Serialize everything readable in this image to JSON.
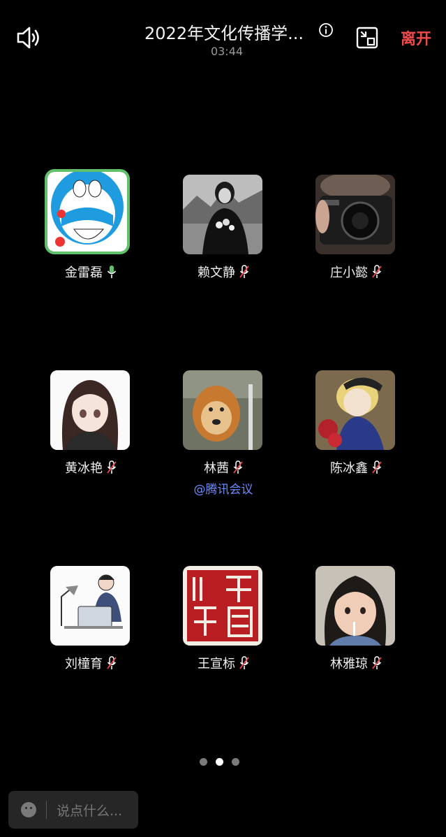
{
  "header": {
    "title": "2022年文化传播学...",
    "timer": "03:44",
    "leave_label": "离开",
    "icons": [
      "speaker-icon",
      "info-icon",
      "shrink-window-icon"
    ]
  },
  "participants": [
    {
      "name": "金雷磊",
      "mic": "on",
      "speaking": true
    },
    {
      "name": "赖文静",
      "mic": "muted"
    },
    {
      "name": "庄小懿",
      "mic": "muted"
    },
    {
      "name": "黄冰艳",
      "mic": "muted"
    },
    {
      "name": "林茜",
      "mic": "muted",
      "sublabel": "@腾讯会议"
    },
    {
      "name": "陈冰鑫",
      "mic": "muted"
    },
    {
      "name": "刘橦育",
      "mic": "muted"
    },
    {
      "name": "王宣标",
      "mic": "muted"
    },
    {
      "name": "林雅琼",
      "mic": "muted"
    }
  ],
  "pagination": {
    "total": 3,
    "current": 2
  },
  "chat": {
    "placeholder": "说点什么..."
  },
  "colors": {
    "leave": "#ef4b4b",
    "speaking_border": "#61c16b",
    "mic_on": "#61c16b",
    "mention": "#6b8cff"
  }
}
